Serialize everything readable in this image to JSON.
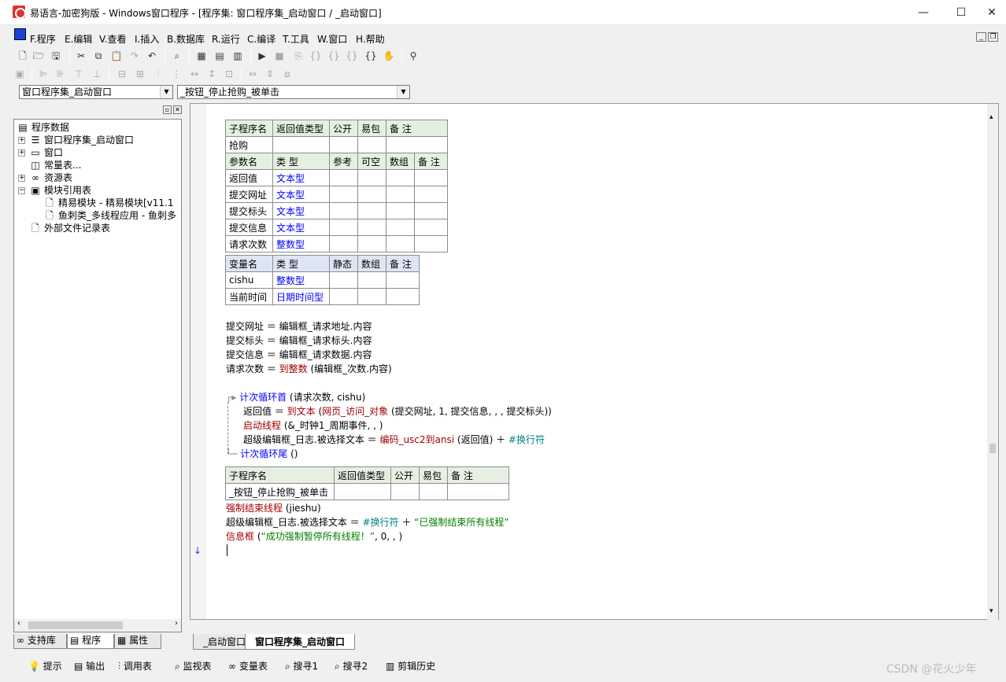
{
  "window": {
    "title": "易语言-加密狗版 - Windows窗口程序 - [程序集: 窗口程序集_启动窗口 / _启动窗口]",
    "minimize": "—",
    "maximize": "☐",
    "close": "✕"
  },
  "menu": {
    "items": [
      "F.程序",
      "E.编辑",
      "V.查看",
      "I.插入",
      "B.数据库",
      "R.运行",
      "C.编译",
      "T.工具",
      "W.窗口",
      "H.帮助"
    ]
  },
  "selectors": {
    "assembly": "窗口程序集_启动窗口",
    "subroutine": "_按钮_停止抢购_被单击"
  },
  "tree": {
    "root": "程序数据",
    "items": [
      "窗口程序集_启动窗口",
      "窗口",
      "常量表...",
      "资源表",
      "模块引用表",
      "精易模块 - 精易模块[v11.1",
      "鱼刺类_多线程应用 - 鱼刺多",
      "外部文件记录表"
    ]
  },
  "left_tabs": [
    "支持库",
    "程序",
    "属性"
  ],
  "sub1": {
    "headers": [
      "子程序名",
      "返回值类型",
      "公开",
      "易包",
      "备 注"
    ],
    "name": "抢购",
    "param_headers": [
      "参数名",
      "类 型",
      "参考",
      "可空",
      "数组",
      "备 注"
    ],
    "params": [
      {
        "name": "返回值",
        "type": "文本型"
      },
      {
        "name": "提交网址",
        "type": "文本型"
      },
      {
        "name": "提交标头",
        "type": "文本型"
      },
      {
        "name": "提交信息",
        "type": "文本型"
      },
      {
        "name": "请求次数",
        "type": "整数型"
      }
    ],
    "var_headers": [
      "变量名",
      "类 型",
      "静态",
      "数组",
      "备 注"
    ],
    "vars": [
      {
        "name": "cishu",
        "type": "整数型"
      },
      {
        "name": "当前时间",
        "type": "日期时间型"
      }
    ]
  },
  "code1": {
    "line1": "提交网址 ＝ 编辑框_请求地址.内容",
    "line2": "提交标头 ＝ 编辑框_请求标头.内容",
    "line3": "提交信息 ＝ 编辑框_请求数据.内容",
    "line4a": "请求次数 ＝ ",
    "line4b": "到整数",
    "line4c": " (编辑框_次数.内容)",
    "loop_a": "计次循环首",
    "loop_b": " (请求次数, cishu)",
    "body1a": "返回值 ＝ ",
    "body1b": "到文本",
    "body1c": " (",
    "body1d": "网页_访问_对象",
    "body1e": " (提交网址, 1, 提交信息, , , 提交标头))",
    "body2a": "启动线程",
    "body2b": " (&_时钟1_周期事件, , )",
    "body3a": "超级编辑框_日志.被选择文本 ＝ ",
    "body3b": "编码_usc2到ansi",
    "body3c": " (返回值) ＋ ",
    "body3d": "#换行符",
    "loop_end_a": "计次循环尾",
    "loop_end_b": " ()"
  },
  "sub2": {
    "headers": [
      "子程序名",
      "返回值类型",
      "公开",
      "易包",
      "备 注"
    ],
    "name": "_按钮_停止抢购_被单击"
  },
  "code2": {
    "l1a": "强制结束线程",
    "l1b": " (jieshu)",
    "l2a": "超级编辑框_日志.被选择文本 ＝ ",
    "l2b": "#换行符",
    "l2c": " ＋ ",
    "l2d": "“已强制结束所有线程”",
    "l3a": "信息框",
    "l3b": " (",
    "l3c": "“成功强制暂停所有线程！”",
    "l3d": ", 0, , )"
  },
  "editor_tabs": [
    "_启动窗口",
    "窗口程序集_启动窗口"
  ],
  "status": [
    "提示",
    "输出",
    "调用表",
    "监视表",
    "变量表",
    "搜寻1",
    "搜寻2",
    "剪辑历史"
  ],
  "watermark": "CSDN @花火少年",
  "colors": {
    "keyword": "#0000ff",
    "function": "#a00000",
    "string": "#008000",
    "header_bg": "#e6f0e2"
  }
}
